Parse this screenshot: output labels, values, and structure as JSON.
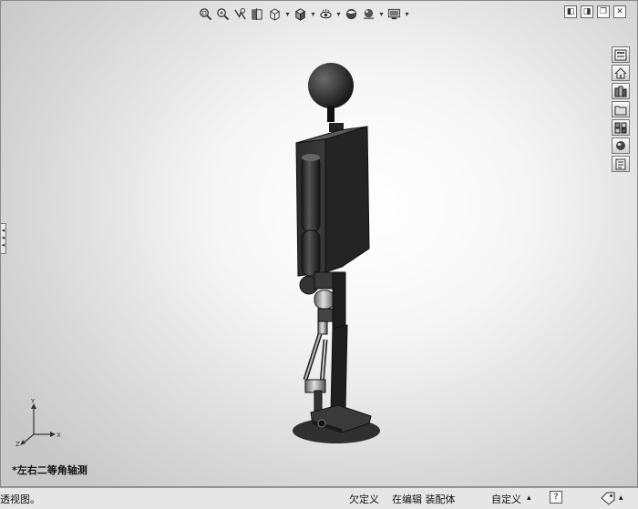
{
  "toolbar": {
    "icons": [
      "zoom-to-fit-icon",
      "zoom-to-area-icon",
      "previous-view-icon",
      "section-view-icon",
      "view-orientation-icon",
      "display-style-icon",
      "hide-show-items-icon",
      "edit-appearance-icon",
      "apply-scene-icon",
      "view-settings-icon"
    ],
    "dropdown_arrow": "▾"
  },
  "window": {
    "icons": [
      "tile-left-icon",
      "tile-right-icon",
      "restore-icon",
      "close-icon"
    ]
  },
  "task_pane": {
    "icons": [
      "resources-icon",
      "home-icon",
      "design-library-icon",
      "file-explorer-icon",
      "view-palette-icon",
      "appearances-icon",
      "custom-properties-icon"
    ]
  },
  "feature_manager": {
    "handle_glyph": "◂\n◂\n◂"
  },
  "triad": {
    "x": "X",
    "y": "Y",
    "z": "Z"
  },
  "view": {
    "label": "*左右二等角轴测"
  },
  "status": {
    "left": "透视图。",
    "underdefined": "欠定义",
    "editing": "在编辑 装配体",
    "custom": "自定义",
    "help": "?"
  },
  "colors": {
    "model_dark": "#2a2a2a",
    "viewport_edge": "#8a8a8a",
    "status_bg": "#e6e6e6"
  }
}
